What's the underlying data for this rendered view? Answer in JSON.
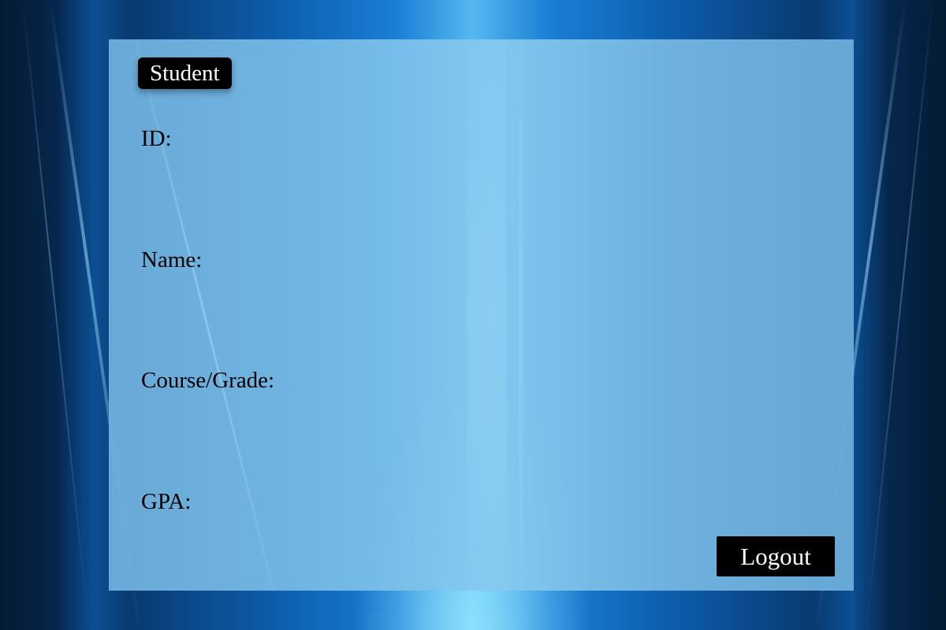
{
  "header": {
    "title": "Student"
  },
  "fields": {
    "id_label": "ID:",
    "name_label": "Name:",
    "course_grade_label": "Course/Grade:",
    "gpa_label": "GPA:"
  },
  "actions": {
    "logout_label": "Logout"
  },
  "colors": {
    "background_primary": "#0d5fb0",
    "panel": "#78bee8",
    "badge": "#000000",
    "button": "#000000",
    "button_text": "#ffffff"
  }
}
